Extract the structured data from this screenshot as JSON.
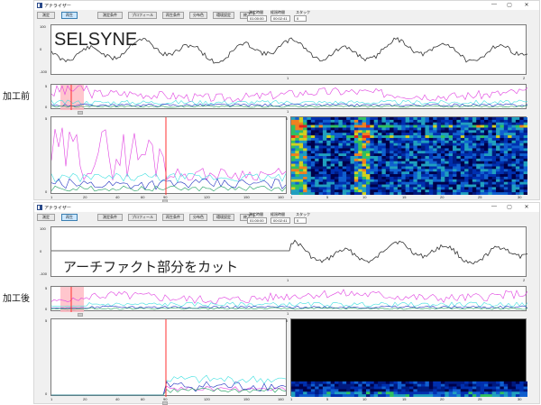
{
  "window": {
    "title": "アナライザー",
    "minimize_glyph": "—",
    "maximize_glyph": "▢",
    "close_glyph": "✕"
  },
  "toolbar": {
    "buttons": [
      "測定",
      "再生",
      "測定条件",
      "プロフィール",
      "再生条件",
      "分布色",
      "環境設定",
      "終了"
    ],
    "active_index": 1,
    "measure_time_label": "測定時間",
    "measure_time_value": "01:00:00",
    "playback_time_label": "経過時間",
    "playback_time_value": "00:02:41",
    "stack_label": "スタック",
    "stack_value": "0"
  },
  "top": {
    "side_label": "加工前",
    "overlay_text": "SELSYNE",
    "waveform_y_ticks": [
      "100",
      "0",
      "-100"
    ],
    "waveform_x_ticks": [
      "1",
      "2"
    ],
    "trend_ticks": [
      "5",
      "0"
    ],
    "trend_x_ticks": [
      "1"
    ],
    "spectrum_y_ticks": [
      "5",
      "0"
    ],
    "spectrum_x_ticks": [
      "1",
      "20",
      "40",
      "60",
      "90",
      "120",
      "150",
      "160"
    ],
    "heatmap_y_ticks": [
      "0"
    ],
    "heatmap_x_ticks": [
      "1",
      "5",
      "10",
      "15",
      "20",
      "25",
      "30"
    ]
  },
  "bottom": {
    "side_label": "加工後",
    "overlay_text": "アーチファクト部分をカット",
    "waveform_y_ticks": [
      "100",
      "0",
      "-100"
    ],
    "waveform_x_ticks": [
      "1",
      "2"
    ],
    "trend_ticks": [
      "5",
      "0"
    ],
    "trend_x_ticks": [
      "1"
    ],
    "spectrum_y_ticks": [
      "5",
      "0"
    ],
    "spectrum_x_ticks": [
      "1",
      "20",
      "40",
      "60",
      "90",
      "120",
      "150",
      "160"
    ],
    "heatmap_y_ticks": [
      "0"
    ],
    "heatmap_x_ticks": [
      "1",
      "5",
      "10",
      "15",
      "20",
      "25",
      "30"
    ]
  },
  "colors": {
    "magenta": "#e040e0",
    "cyan": "#40e0e0",
    "blue": "#2030c0",
    "green": "#20a060",
    "marker": "#ff3030",
    "selection": "#ffb8c0"
  }
}
